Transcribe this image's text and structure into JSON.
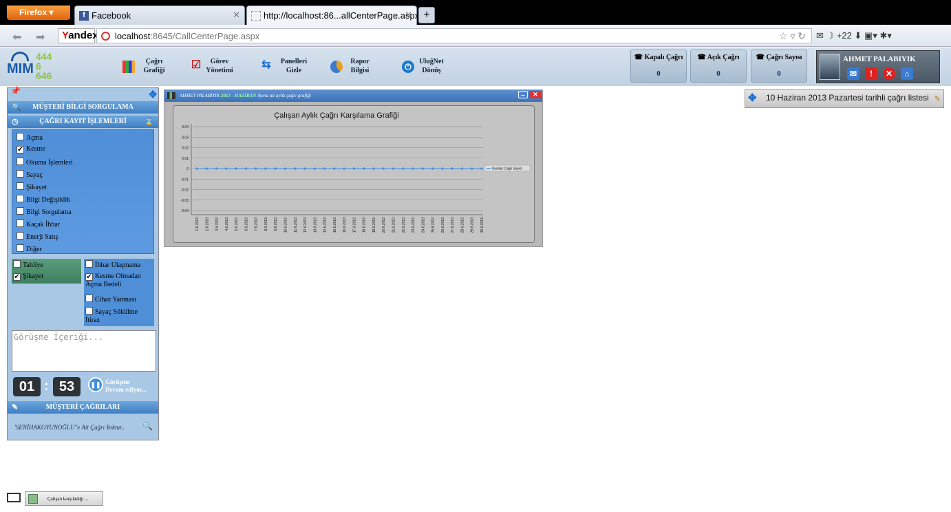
{
  "browser": {
    "app_button": "Firefox",
    "tabs": [
      {
        "label": "Facebook"
      },
      {
        "label": "http://localhost:86...allCenterPage.aspx"
      }
    ],
    "new_tab": "+",
    "search_engine": "Yandex",
    "url_host": "localhost",
    "url_path": ":8645/CallCenterPage.aspx",
    "badge_count": "+22"
  },
  "header": {
    "logo_text": "MIM",
    "logo_number": [
      "444",
      "6",
      "646"
    ],
    "menu": [
      {
        "line1": "Çağrı",
        "line2": "Grafiği"
      },
      {
        "line1": "Görev",
        "line2": "Yönetimi"
      },
      {
        "line1": "Panelleri",
        "line2": "Gizle"
      },
      {
        "line1": "Rapor",
        "line2": "Bilgisi"
      },
      {
        "line1": "UluğNet",
        "line2": "Dönüş"
      }
    ],
    "stats": [
      {
        "label": "Kapalı Çağrı",
        "value": "0"
      },
      {
        "label": "Açık Çağrı",
        "value": "0"
      },
      {
        "label": "Çağrı Sayısı",
        "value": "0"
      }
    ],
    "user_name": "AHMET PALABIYIK"
  },
  "left_panel": {
    "customer_query": "MÜŞTERİ BİLGİ SORGULAMA",
    "call_record": "ÇAĞRI KAYIT İŞLEMLERİ",
    "options": [
      {
        "label": "Açma",
        "checked": false
      },
      {
        "label": "Kesme",
        "checked": true
      },
      {
        "label": "Okuma İşlemleri",
        "checked": false
      },
      {
        "label": "Sayaç",
        "checked": false
      },
      {
        "label": "Şikayet",
        "checked": false
      },
      {
        "label": "Bilgi Değişiklik",
        "checked": false
      },
      {
        "label": "Bilgi Sorgulama",
        "checked": false
      },
      {
        "label": "Kaçak İhbar",
        "checked": false
      },
      {
        "label": "Enerji Satış",
        "checked": false
      },
      {
        "label": "Diğer",
        "checked": false
      }
    ],
    "type_options": [
      {
        "label": "Tahliye",
        "checked": false
      },
      {
        "label": "Şikayet",
        "checked": true
      }
    ],
    "issue_options": [
      {
        "label": "İhbar Ulaşmama",
        "checked": false
      },
      {
        "label": "Kesme Olmadan Açma Bedeli",
        "checked": true
      },
      {
        "label": "Cihaz Yanması",
        "checked": false
      },
      {
        "label": "Sayaç Sökülme İtiraz",
        "checked": false
      }
    ],
    "notes_placeholder": "Görüşme İçeriği...",
    "timer_min": "01",
    "timer_sep": ":",
    "timer_sec": "53",
    "status_line1": "Görüşme",
    "status_line2": "Devam ediyor...",
    "customer_calls": "MÜŞTERİ ÇAĞRILARI",
    "no_calls_note": "'SENİHAKOYUNOĞLU''e Ait Çağrı Yoktur.."
  },
  "chart_window": {
    "bar_user": "AHMET PALABIYIK",
    "bar_year": "2013",
    "bar_dash": "-",
    "bar_month": "HAZİRAN",
    "bar_desc": "Ayına ait aylık çağrı grafiği"
  },
  "chart_data": {
    "type": "line",
    "title": "Çalışan Aylık Çağrı Karşılama Grafiği",
    "x": [
      "1.6.2013",
      "2.6.2013",
      "3.6.2013",
      "4.6.2013",
      "5.6.2013",
      "6.6.2013",
      "7.6.2013",
      "8.6.2013",
      "9.6.2013",
      "10.6.2013",
      "11.6.2013",
      "12.6.2013",
      "13.6.2013",
      "14.6.2013",
      "15.6.2013",
      "16.6.2013",
      "17.6.2013",
      "18.6.2013",
      "19.6.2013",
      "20.6.2013",
      "21.6.2013",
      "22.6.2013",
      "23.6.2013",
      "24.6.2013",
      "25.6.2013",
      "26.6.2013",
      "27.6.2013",
      "28.6.2013",
      "29.6.2013",
      "30.6.2013"
    ],
    "series": [
      {
        "name": "Gunluk Cagri Sayisi",
        "values": [
          0,
          0,
          0,
          0,
          0,
          0,
          0,
          0,
          0,
          0,
          0,
          0,
          0,
          0,
          0,
          0,
          0,
          0,
          0,
          0,
          0,
          0,
          0,
          0,
          0,
          0,
          0,
          0,
          0,
          0
        ],
        "color": "#3a8ee6"
      }
    ],
    "yticks": [
      "0.04",
      "0.03",
      "0.02",
      "0.01",
      "0",
      "-0.01",
      "-0.02",
      "-0.03",
      "-0.04"
    ],
    "ylim": [
      -0.04,
      0.04
    ],
    "legend": "right",
    "grid": true
  },
  "right_list": {
    "title": "10 Haziran 2013 Pazartesi  tarihli çağrı listesi"
  },
  "taskbar": {
    "item": "Çalışan karşıladığı ..."
  }
}
